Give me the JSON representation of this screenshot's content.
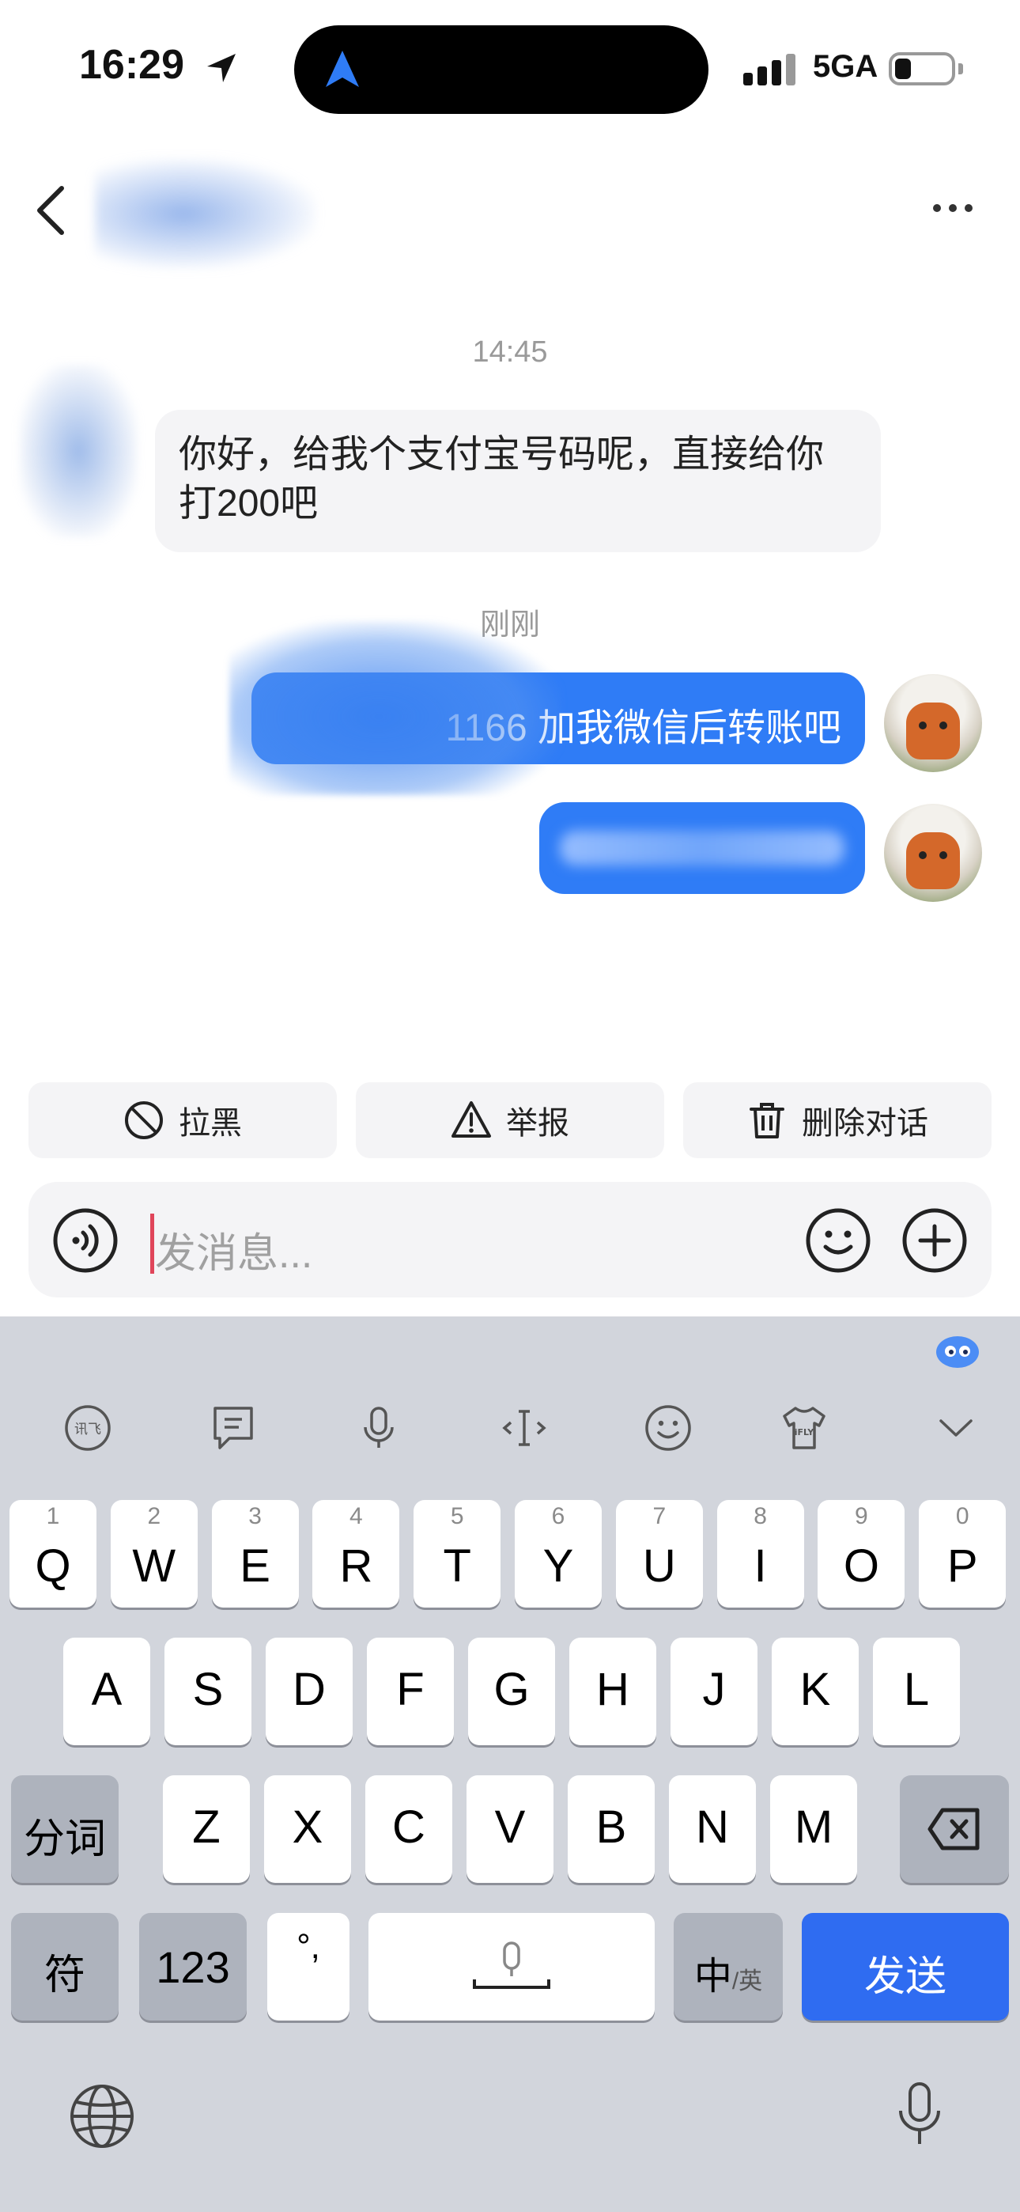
{
  "status_bar": {
    "time": "16:29",
    "network": "5GA"
  },
  "header": {
    "more_label": "···"
  },
  "chat": {
    "timestamps": [
      "14:45",
      "刚刚"
    ],
    "messages": [
      {
        "side": "incoming",
        "text": "你好，给我个支付宝号码呢，直接给你打200吧"
      },
      {
        "side": "outgoing",
        "text": "1166 加我微信后转账吧"
      },
      {
        "side": "outgoing",
        "text": ""
      }
    ]
  },
  "actions": {
    "block": "拉黑",
    "report": "举报",
    "delete": "删除对话"
  },
  "input": {
    "placeholder": "发消息..."
  },
  "keyboard": {
    "row1": [
      {
        "hint": "1",
        "key": "Q"
      },
      {
        "hint": "2",
        "key": "W"
      },
      {
        "hint": "3",
        "key": "E"
      },
      {
        "hint": "4",
        "key": "R"
      },
      {
        "hint": "5",
        "key": "T"
      },
      {
        "hint": "6",
        "key": "Y"
      },
      {
        "hint": "7",
        "key": "U"
      },
      {
        "hint": "8",
        "key": "I"
      },
      {
        "hint": "9",
        "key": "O"
      },
      {
        "hint": "0",
        "key": "P"
      }
    ],
    "row2": [
      "A",
      "S",
      "D",
      "F",
      "G",
      "H",
      "J",
      "K",
      "L"
    ],
    "row3": [
      "Z",
      "X",
      "C",
      "V",
      "B",
      "N",
      "M"
    ],
    "fenci": "分词",
    "fu": "符",
    "num": "123",
    "punct": "°,",
    "zhong": "中",
    "ying": "/英",
    "send": "发送"
  },
  "colors": {
    "accent": "#2f7cf6",
    "send_key": "#2f6cf1",
    "bubble_in": "#f4f4f6",
    "keyboard_bg": "#d2d5dc"
  }
}
